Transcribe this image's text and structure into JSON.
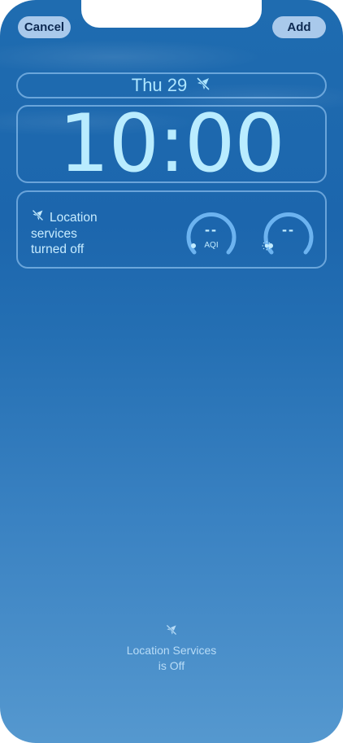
{
  "toolbar": {
    "cancel_label": "Cancel",
    "add_label": "Add"
  },
  "date_widget": {
    "date": "Thu 29",
    "icon": "location-off-icon"
  },
  "clock": {
    "time": "10:00"
  },
  "widgets": {
    "location": {
      "icon": "location-off-icon",
      "line1": "Location",
      "line2": "services",
      "line3": "turned off"
    },
    "aqi": {
      "value": "--",
      "label": "AQI"
    },
    "uv": {
      "value": "--",
      "icon": "sun-icon"
    }
  },
  "status": {
    "icon": "location-off-icon",
    "line1": "Location Services",
    "line2": "is Off"
  },
  "colors": {
    "accent": "#aee6ff",
    "button_bg": "#a9c9eb",
    "button_text": "#0e2a52"
  }
}
